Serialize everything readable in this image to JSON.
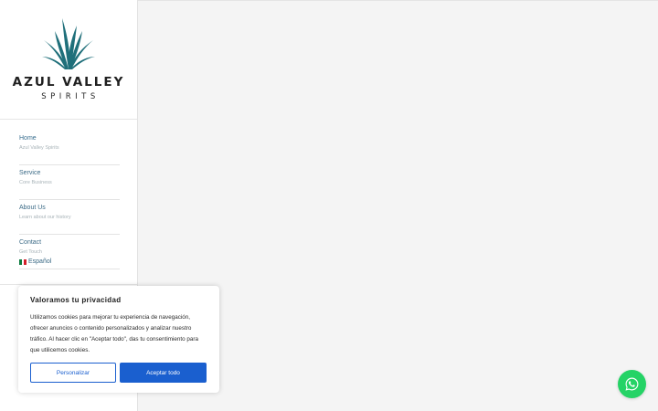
{
  "brand": {
    "name": "AZUL VALLEY",
    "subtitle": "SPIRITS",
    "logo_icon": "agave-logo-icon",
    "colors": {
      "logo": "#1f6f7a",
      "text": "#1f1f1f"
    }
  },
  "nav": {
    "items": [
      {
        "label": "Home",
        "desc": "Azul Valley Spirits"
      },
      {
        "label": "Service",
        "desc": "Core Business"
      },
      {
        "label": "About Us",
        "desc": "Learn about our history"
      },
      {
        "label": "Contact",
        "desc": "Get Touch"
      }
    ],
    "language": {
      "label": "Español",
      "flag_icon": "mexico-flag-icon"
    }
  },
  "cookie": {
    "title": "Valoramos tu privacidad",
    "text": "Utilizamos cookies para mejorar tu experiencia de navegación, ofrecer anuncios o contenido personalizados y analizar nuestro tráfico. Al hacer clic en \"Aceptar todo\", das tu consentimiento para que utilicemos cookies.",
    "customize_label": "Personalizar",
    "accept_label": "Aceptar todo",
    "accent_color": "#1a5fcf"
  },
  "whatsapp": {
    "icon": "whatsapp-icon",
    "color": "#25d366"
  }
}
